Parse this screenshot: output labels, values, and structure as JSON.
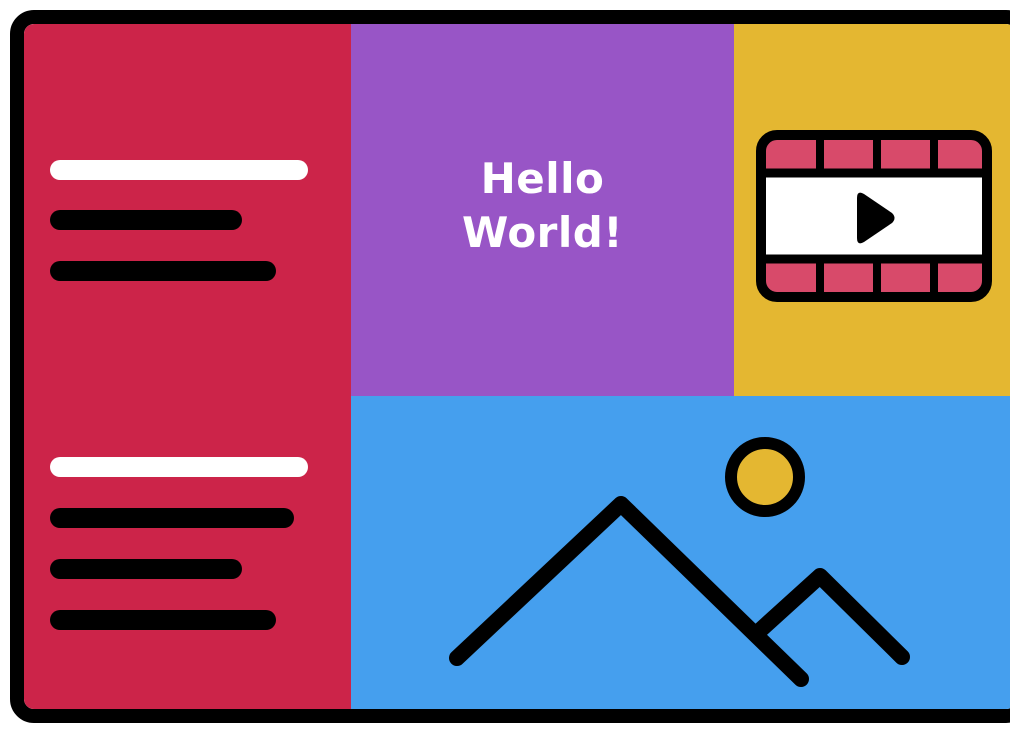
{
  "hero": {
    "greeting": "Hello\nWorld!"
  },
  "colors": {
    "frame": "#000000",
    "sidebar": "#cc2449",
    "purple_panel": "#9855c6",
    "yellow_panel": "#e4b731",
    "blue_panel": "#459fee",
    "film_perforations": "#d84a6a",
    "sun": "#e4b731"
  },
  "icons": [
    "video-film-icon",
    "play-icon",
    "image-landscape-icon",
    "sun-icon",
    "mountain-icon"
  ]
}
